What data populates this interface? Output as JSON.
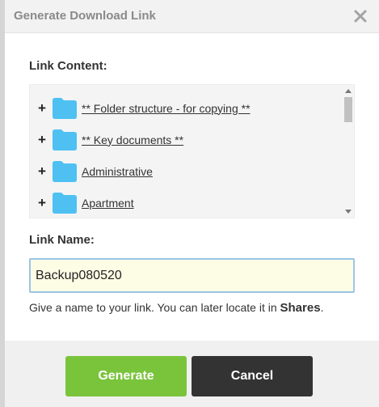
{
  "dialog": {
    "title": "Generate Download Link",
    "link_content_label": "Link Content:",
    "link_name_label": "Link Name:"
  },
  "tree": {
    "items": [
      {
        "expand": "+",
        "label": "** Folder structure - for copying **"
      },
      {
        "expand": "+",
        "label": "** Key documents **"
      },
      {
        "expand": "+",
        "label": "Administrative"
      },
      {
        "expand": "+",
        "label": "Apartment"
      }
    ]
  },
  "link_name": {
    "value": "Backup080520"
  },
  "hint": {
    "text": "Give a name to your link. You can later locate it in ",
    "emphasis": "Shares",
    "suffix": "."
  },
  "buttons": {
    "generate_label": "Generate",
    "cancel_label": "Cancel"
  },
  "colors": {
    "generate": "#7ac43c",
    "cancel": "#333333",
    "folder": "#4ec1f2",
    "input_bg": "#fdfde6",
    "input_border": "#9cc4e6"
  },
  "icons": {
    "close": "close-icon",
    "folder": "folder-icon",
    "expand": "plus-icon"
  }
}
